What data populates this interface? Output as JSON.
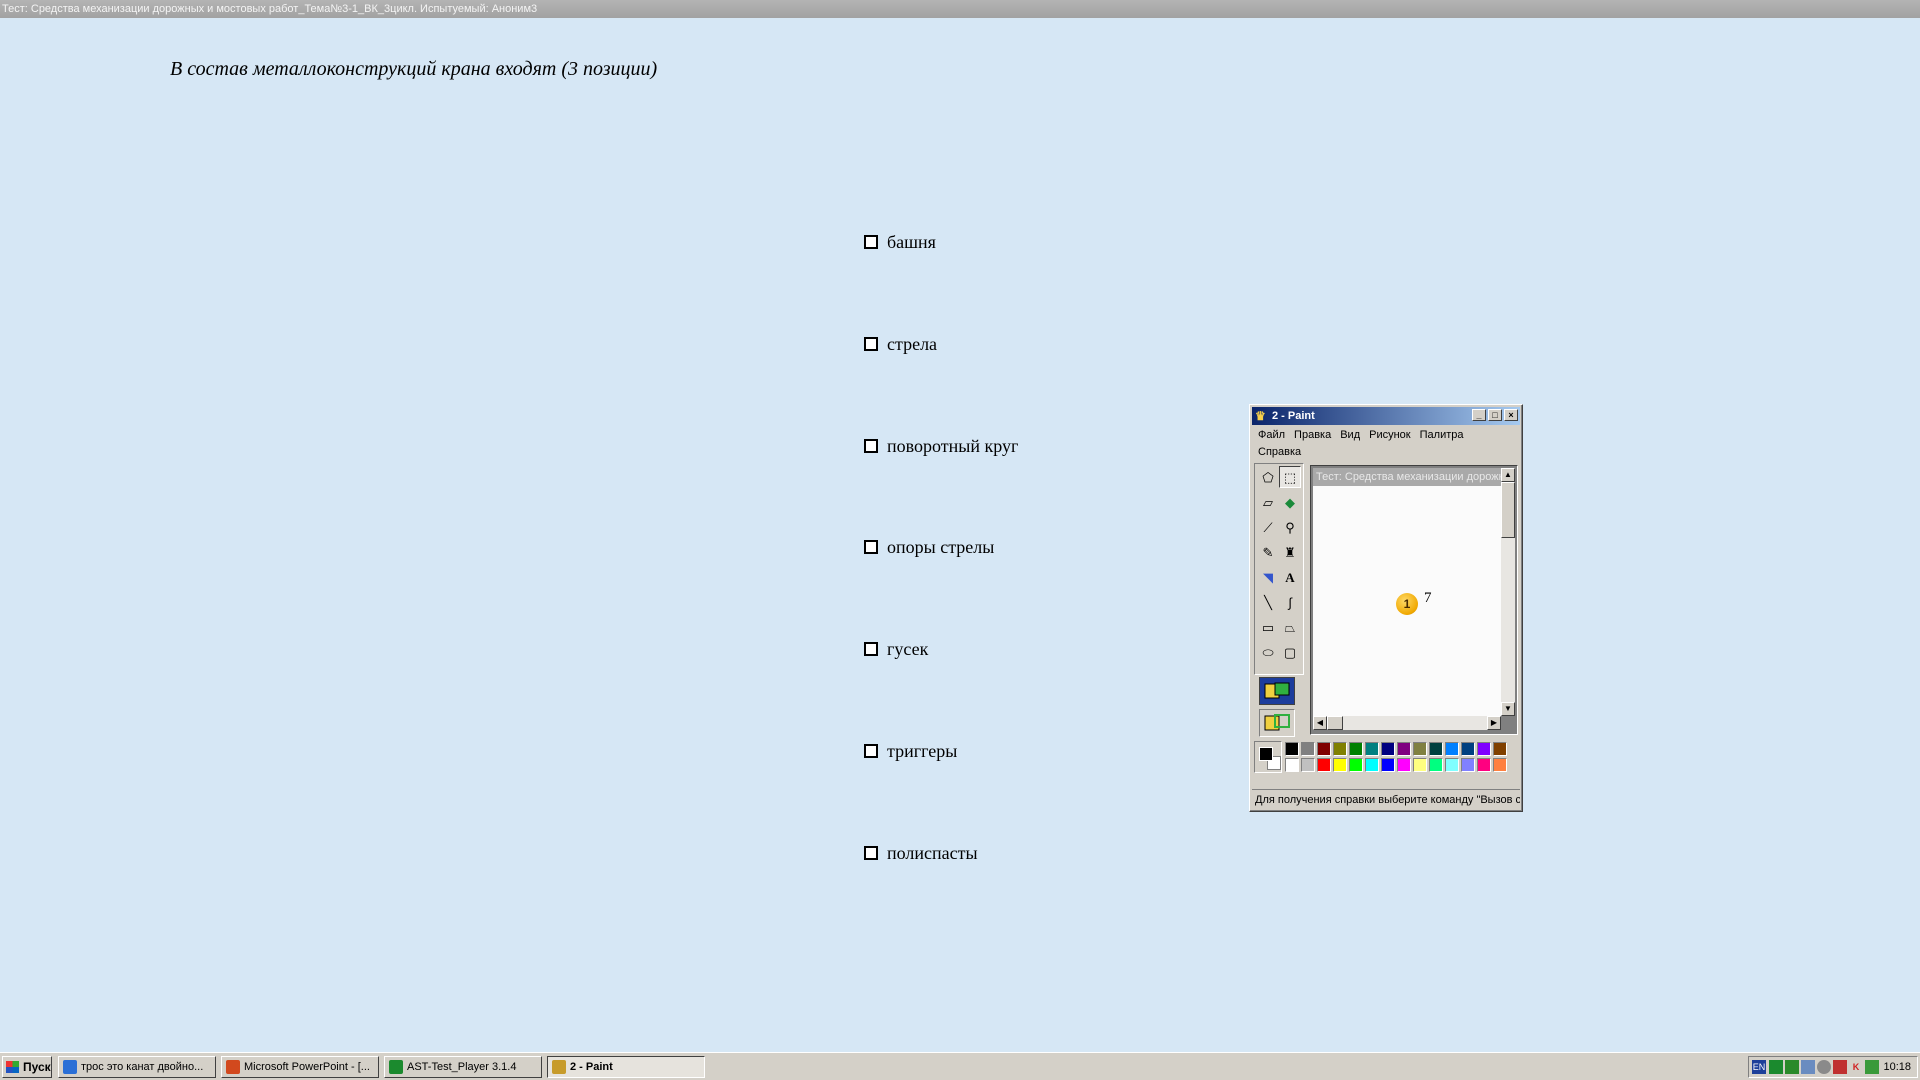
{
  "app": {
    "title": "Тест: Средства механизации дорожных и мостовых работ_Тема№3-1_ВК_3цикл. Испытуемый: Аноним3"
  },
  "question": {
    "text": "В состав металлоконструкций крана входят (3 позиции)",
    "answers": [
      {
        "label": "башня",
        "checked": false
      },
      {
        "label": "стрела",
        "checked": false
      },
      {
        "label": "поворотный круг",
        "checked": false
      },
      {
        "label": "опоры стрелы",
        "checked": false
      },
      {
        "label": "гусек",
        "checked": false
      },
      {
        "label": "триггеры",
        "checked": false
      },
      {
        "label": "полиспасты",
        "checked": false
      }
    ]
  },
  "paint": {
    "title": "2 - Paint",
    "menu": [
      "Файл",
      "Правка",
      "Вид",
      "Рисунок",
      "Палитра",
      "Справка"
    ],
    "canvas_caption": "Тест: Средства механизации дорожных",
    "badge_number": "1",
    "badge_label": "7",
    "status": "Для получения справки выберите команду \"Вызов справки\"",
    "tools": [
      "free-select-icon",
      "rect-select-icon",
      "eraser-icon",
      "fill-icon",
      "color-picker-icon",
      "magnifier-icon",
      "pencil-icon",
      "brush-icon",
      "airbrush-icon",
      "text-icon",
      "line-icon",
      "curve-icon",
      "rectangle-icon",
      "polygon-icon",
      "ellipse-icon",
      "rounded-rect-icon"
    ],
    "palette_top": [
      "#000000",
      "#808080",
      "#800000",
      "#808000",
      "#008000",
      "#008080",
      "#000080",
      "#800080",
      "#808040",
      "#004040",
      "#0080ff",
      "#004080",
      "#8000ff",
      "#804000"
    ],
    "palette_bottom": [
      "#ffffff",
      "#c0c0c0",
      "#ff0000",
      "#ffff00",
      "#00ff00",
      "#00ffff",
      "#0000ff",
      "#ff00ff",
      "#ffff80",
      "#00ff80",
      "#80ffff",
      "#8080ff",
      "#ff0080",
      "#ff8040"
    ]
  },
  "taskbar": {
    "start_label": "Пуск",
    "tasks": [
      {
        "label": "трос это канат двойно...",
        "icon_color": "#2a6fd6",
        "active": false
      },
      {
        "label": "Microsoft PowerPoint - [...",
        "icon_color": "#d2491e",
        "active": false
      },
      {
        "label": "AST-Test_Player  3.1.4",
        "icon_color": "#1b8a2e",
        "active": false
      },
      {
        "label": "2 - Paint",
        "icon_color": "#c79b2a",
        "active": true
      }
    ],
    "lang": "EN",
    "time": "10:18"
  }
}
